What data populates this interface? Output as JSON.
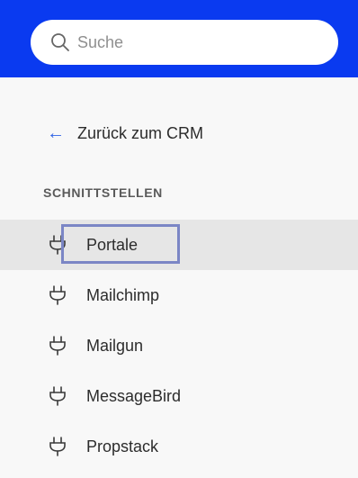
{
  "search": {
    "placeholder": "Suche",
    "icon": "search-icon"
  },
  "back_link": {
    "label": "Zurück zum CRM",
    "icon": "arrow-left-icon"
  },
  "section_title": "SCHNITTSTELLEN",
  "nav_items": [
    {
      "label": "Portale",
      "icon": "plug-icon",
      "active": true
    },
    {
      "label": "Mailchimp",
      "icon": "plug-icon"
    },
    {
      "label": "Mailgun",
      "icon": "plug-icon"
    },
    {
      "label": "MessageBird",
      "icon": "plug-icon"
    },
    {
      "label": "Propstack",
      "icon": "plug-icon"
    }
  ],
  "colors": {
    "topbar": "#0a3af0",
    "accent": "#2f62e5",
    "active_bg": "#e6e6e6",
    "focus": "#7b86c5"
  }
}
